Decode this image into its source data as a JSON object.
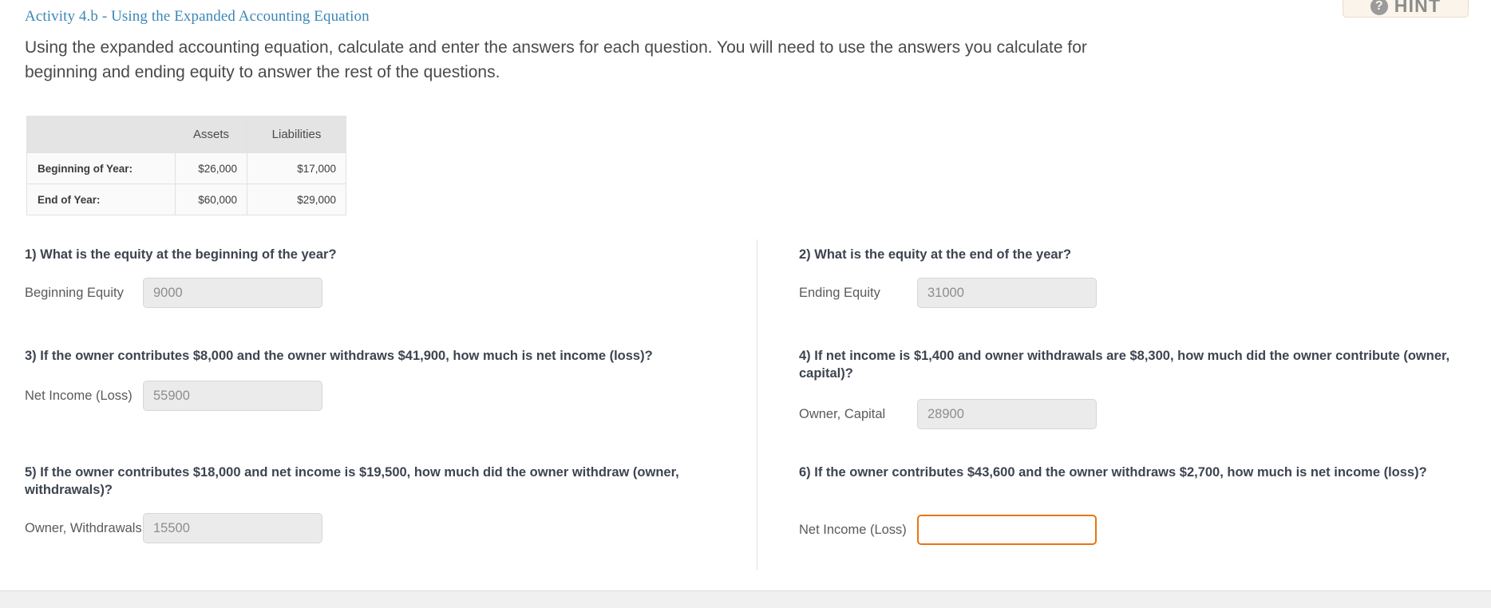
{
  "hint": {
    "label": "HINT",
    "icon": "question-mark-circle-icon",
    "glyph": "?"
  },
  "activity": {
    "title": "Activity 4.b - Using the Expanded Accounting Equation",
    "title_color": "#3b87b5",
    "intro": "Using the expanded accounting equation, calculate and enter the answers for each question. You will need to use the answers you calculate for beginning and ending equity to answer the rest of the questions."
  },
  "table": {
    "headers": [
      "",
      "Assets",
      "Liabilities"
    ],
    "rows": [
      {
        "label": "Beginning of Year:",
        "assets": "$26,000",
        "liabilities": "$17,000"
      },
      {
        "label": "End of Year:",
        "assets": "$60,000",
        "liabilities": "$29,000"
      }
    ]
  },
  "questions": [
    {
      "id": "q1",
      "text": "1) What is the equity at the beginning of the year?",
      "field_label": "Beginning Equity",
      "value": "9000",
      "focused": false
    },
    {
      "id": "q2",
      "text": "2) What is the equity at the end of the year?",
      "field_label": "Ending Equity",
      "value": "31000",
      "focused": false
    },
    {
      "id": "q3",
      "text": "3) If the owner contributes $8,000 and the owner withdraws $41,900, how much is net income (loss)?",
      "field_label": "Net Income (Loss)",
      "value": "55900",
      "focused": false
    },
    {
      "id": "q4",
      "text": "4) If net income is $1,400 and owner withdrawals are $8,300, how much did the owner contribute (owner, capital)?",
      "field_label": "Owner, Capital",
      "value": "28900",
      "focused": false
    },
    {
      "id": "q5",
      "text": "5) If the owner contributes $18,000 and net income is $19,500, how much did the owner withdraw (owner, withdrawals)?",
      "field_label": "Owner, Withdrawals",
      "value": "15500",
      "focused": false
    },
    {
      "id": "q6",
      "text": "6) If the owner contributes $43,600 and the owner withdraws $2,700, how much is net income (loss)?",
      "field_label": "Net Income (Loss)",
      "value": "",
      "focused": true
    }
  ],
  "colors": {
    "accent_focus": "#e87511",
    "title_link": "#3b87b5",
    "input_fill": "#ebebeb",
    "table_header": "#e4e4e4"
  }
}
